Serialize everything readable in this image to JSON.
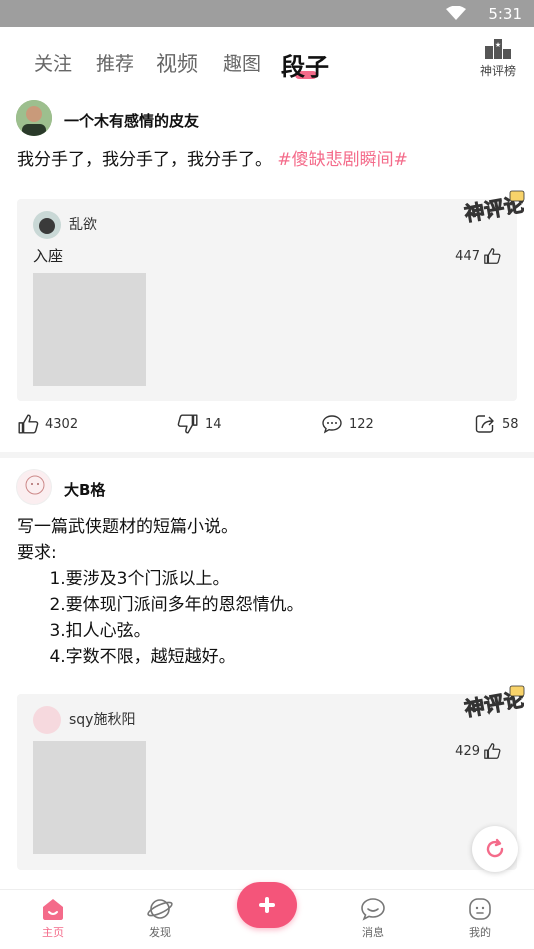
{
  "status_bar": {
    "time": "5:31"
  },
  "tabs": [
    {
      "label": "关注"
    },
    {
      "label": "推荐"
    },
    {
      "label": "视频"
    },
    {
      "label": "趣图"
    },
    {
      "label": "段子"
    }
  ],
  "rank": {
    "label": "神评榜"
  },
  "posts": [
    {
      "author": "一个木有感情的皮友",
      "text": "我分手了，我分手了，我分手了。",
      "hashtag": "#傻缺悲剧瞬间#",
      "comment": {
        "author": "乱欲",
        "text": "入座",
        "likes": "447"
      },
      "likes": "4302",
      "dislikes": "14",
      "comments": "122",
      "shares": "58"
    },
    {
      "author": "大B格",
      "text": "写一篇武侠题材的短篇小说。\n要求:\n      1.要涉及3个门派以上。\n      2.要体现门派间多年的恩怨情仇。\n      3.扣人心弦。\n      4.字数不限，越短越好。",
      "comment": {
        "author": "sqy施秋阳",
        "likes": "429"
      }
    }
  ],
  "badge": {
    "text": "神评论",
    "color": "#f46b8a"
  },
  "bottom_nav": [
    {
      "label": "主页",
      "icon": "home-icon"
    },
    {
      "label": "发现",
      "icon": "planet-icon"
    },
    {
      "label": "消息",
      "icon": "message-icon"
    },
    {
      "label": "我的",
      "icon": "profile-icon"
    }
  ],
  "colors": {
    "accent": "#f46b8a",
    "publish": "#f4557a",
    "card_bg": "#f4f4f4"
  }
}
